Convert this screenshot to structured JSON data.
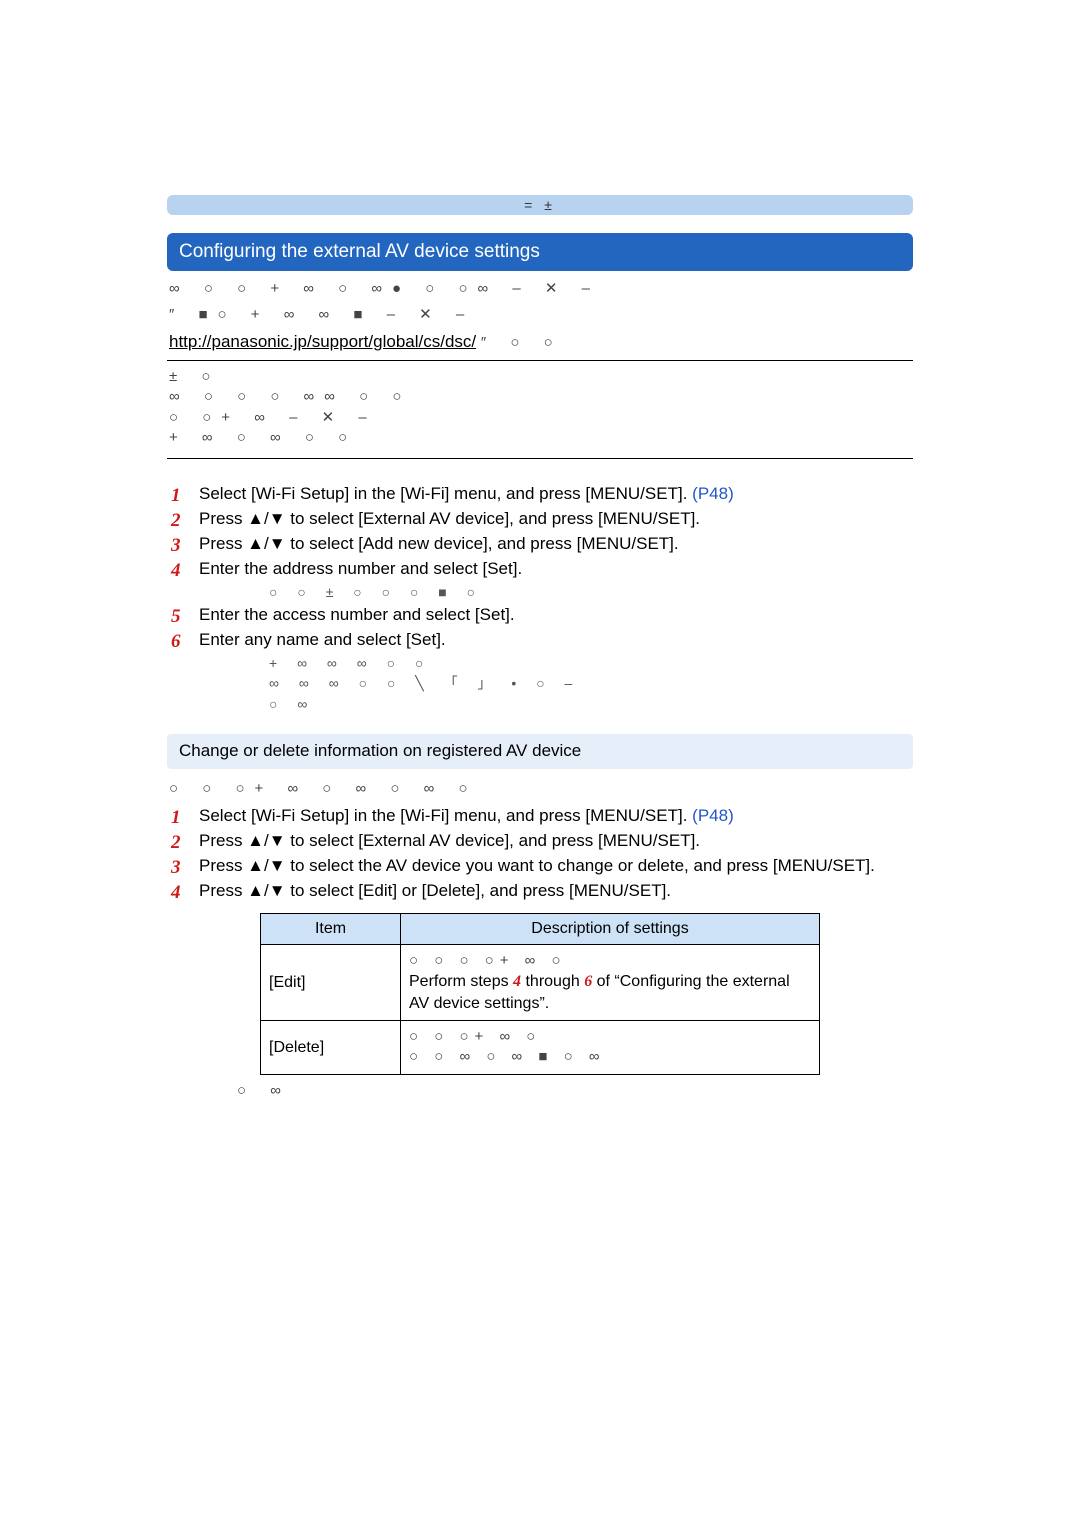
{
  "band_symbols": "=  ±",
  "section1": {
    "title": "Configuring the external AV device settings",
    "sym_line1": "∞ ○     ○       +       ∞               ○    ∞● ○ ○∞       – ✕     –",
    "sym_line2": "″          ■○       +       ∞        ∞           ■   – ✕   –",
    "url": "http://panasonic.jp/support/global/cs/dsc/",
    "url_tail": "    ″           ○     ○",
    "note_l1": "±        ○",
    "note_l2": "  ∞           ○             ○          ○    ∞∞   ○               ○",
    "note_l3": "   ○   ○+     ∞           – ✕   –",
    "note_l4": "            +     ∞ ○    ∞ ○   ○"
  },
  "stepsA": {
    "s1a": "Select [Wi-Fi Setup] in the [Wi-Fi] menu, and press [MENU/SET]. ",
    "s1b": "(P48)",
    "s2": "Press ▲/▼ to select [External AV device], and press [MENU/SET].",
    "s3": "Press ▲/▼ to select [Add new device], and press [MENU/SET].",
    "s4": "Enter the address number and select [Set].",
    "s4sym": "○  ○      ±     ○      ○ ○  ■    ○",
    "s5": "Enter the access number and select [Set].",
    "s6": "Enter any name and select [Set].",
    "s6sym1": "+          ∞    ∞    ∞ ○    ○",
    "s6sym2": "∞    ∞    ∞ ○    ○       ╲   「   」  •  ○  –",
    "s6sym3": "○           ∞"
  },
  "subsection": {
    "title": "Change or delete information on registered AV device",
    "lead_sym": "○       ○ ○+      ∞                   ○       ∞ ○    ∞  ○"
  },
  "stepsB": {
    "s1a": "Select [Wi-Fi Setup] in the [Wi-Fi] menu, and press [MENU/SET]. ",
    "s1b": "(P48)",
    "s2": "Press ▲/▼ to select [External AV device], and press [MENU/SET].",
    "s3": "Press ▲/▼ to select the AV device you want to change or delete, and press [MENU/SET].",
    "s4": "Press ▲/▼ to select [Edit] or [Delete], and press [MENU/SET]."
  },
  "table": {
    "h_item": "Item",
    "h_desc": "Description of settings",
    "edit_label": "[Edit]",
    "edit_sym": "○   ○      ○ ○+       ∞                       ○",
    "edit_a": "Perform steps ",
    "edit_b": " through ",
    "edit_c": " of “Configuring the external AV device settings”.",
    "edit_n4": "4",
    "edit_n6": "6",
    "del_label": "[Delete]",
    "del_sym1": "○        ○ ○+       ∞                  ○",
    "del_sym2": "○     ○ ∞  ○               ∞      ■  ○           ∞"
  },
  "footer_sym": "○           ∞"
}
